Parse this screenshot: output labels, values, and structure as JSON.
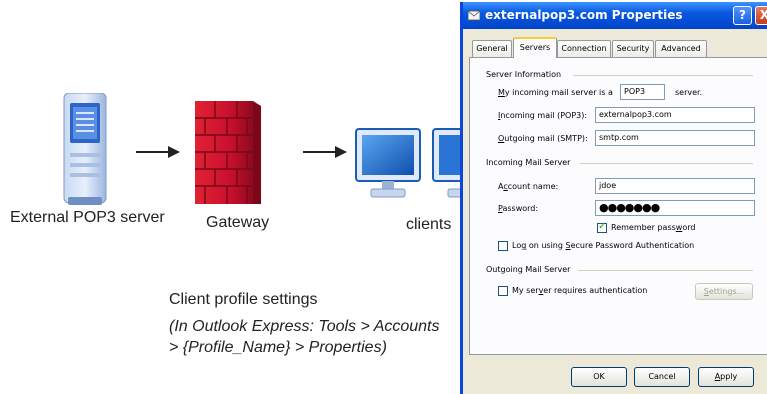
{
  "diagram": {
    "server_label": "External POP3 server",
    "gateway_label": "Gateway",
    "clients_label": "clients",
    "caption_title": "Client profile settings",
    "caption_line1": "(In Outlook Express: Tools > Accounts",
    "caption_line2": "> {Profile_Name} > Properties)"
  },
  "dialog": {
    "title": "externalpop3.com Properties",
    "help_label": "?",
    "close_label": "X",
    "tabs": [
      {
        "label": "General"
      },
      {
        "label": "Servers"
      },
      {
        "label": "Connection"
      },
      {
        "label": "Security"
      },
      {
        "label": "Advanced"
      }
    ],
    "active_tab": "Servers",
    "server_info": {
      "heading": "Server Information",
      "type_prefix": "My incoming mail server is a",
      "type_value": "POP3",
      "type_suffix": "server.",
      "incoming_label": "Incoming mail (POP3):",
      "incoming_value": "externalpop3.com",
      "outgoing_label": "Outgoing mail (SMTP):",
      "outgoing_value": "smtp.com"
    },
    "incoming_server": {
      "heading": "Incoming Mail Server",
      "account_label": "Account name:",
      "account_value": "jdoe",
      "password_label": "Password:",
      "password_value": "●●●●●●●",
      "remember_label": "Remember password",
      "remember_checked": true,
      "spa_label": "Log on using Secure Password Authentication",
      "spa_checked": false
    },
    "outgoing_server": {
      "heading": "Outgoing Mail Server",
      "auth_label": "My server requires authentication",
      "auth_checked": false,
      "settings_label": "Settings..."
    },
    "buttons": {
      "ok": "OK",
      "cancel": "Cancel",
      "apply": "Apply"
    }
  },
  "colors": {
    "titlebar": "#0a58e0",
    "firewall": "#c8102e",
    "dialog_bg": "#ece9d8",
    "monitor_blue": "#1a6fd0"
  },
  "icons": {
    "server": "server-tower-icon",
    "gateway": "firewall-brick-wall-icon",
    "client": "monitor-icon",
    "title": "mail-properties-icon"
  }
}
